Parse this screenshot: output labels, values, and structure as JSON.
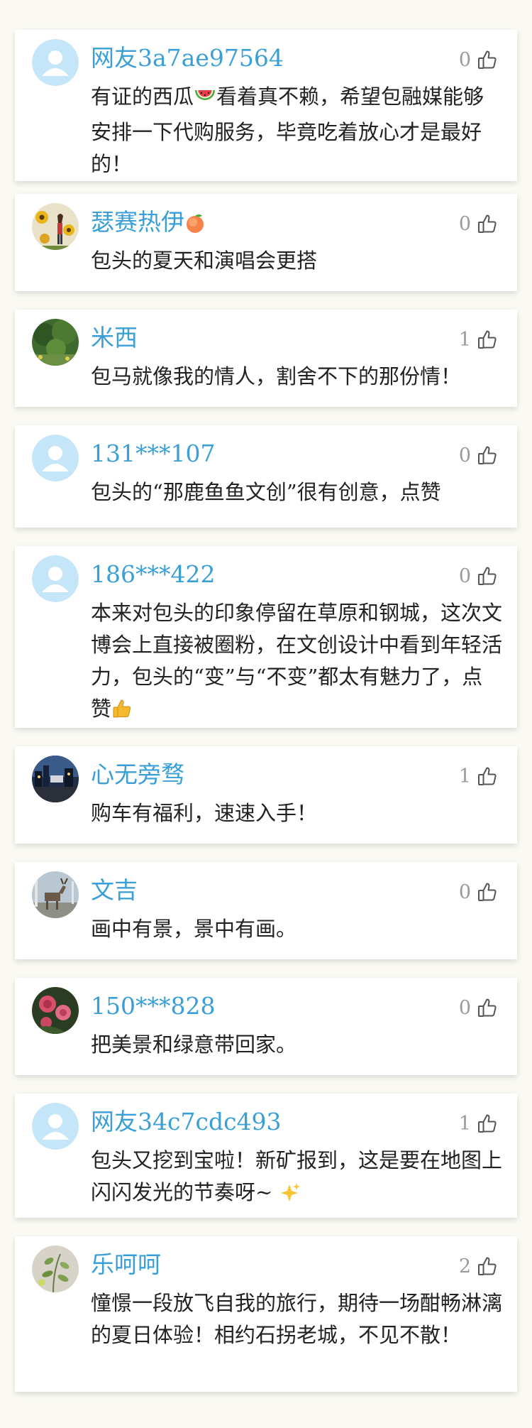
{
  "colors": {
    "page_background": "#faf9f3",
    "card_background": "#ffffff",
    "username": "#3a9fd6",
    "comment_text": "#222222",
    "like_count": "#9a9a9a",
    "default_avatar": "#c5e5f8"
  },
  "comments": [
    {
      "name": "网友3a7ae97564",
      "avatar": "default-avatar",
      "likes": "0",
      "segments": [
        "有证的西瓜",
        "watermelon-emoji",
        "看着真不赖，希望包融媒能够安排一下代购服务，毕竟吃着放心才是最好的！"
      ]
    },
    {
      "name": "瑟赛热伊",
      "name_emoji": "peach-emoji",
      "avatar": "photo-avatar-sunflowers",
      "likes": "0",
      "segments": [
        "包头的夏天和演唱会更搭"
      ]
    },
    {
      "name": "米西",
      "avatar": "photo-avatar-trees",
      "likes": "1",
      "segments": [
        "包马就像我的情人，割舍不下的那份情！"
      ]
    },
    {
      "name": "131***107",
      "avatar": "default-avatar",
      "likes": "0",
      "segments": [
        "包头的“那鹿鱼鱼文创”很有创意，点赞"
      ]
    },
    {
      "name": "186***422",
      "avatar": "default-avatar",
      "likes": "0",
      "segments": [
        "本来对包头的印象停留在草原和钢城，这次文博会上直接被圈粉，在文创设计中看到年轻活力，包头的“变”与“不变”都太有魅力了，点赞",
        "thumbs-up-emoji"
      ]
    },
    {
      "name": "心无旁骛",
      "avatar": "photo-avatar-night-city",
      "likes": "1",
      "segments": [
        "购车有福利，速速入手！"
      ]
    },
    {
      "name": "文吉",
      "avatar": "photo-avatar-deer-statue",
      "likes": "0",
      "segments": [
        "画中有景，景中有画。"
      ]
    },
    {
      "name": "150***828",
      "avatar": "photo-avatar-pink-flowers",
      "likes": "0",
      "segments": [
        "把美景和绿意带回家。"
      ]
    },
    {
      "name": "网友34c7cdc493",
      "avatar": "default-avatar",
      "likes": "1",
      "segments": [
        "包头又挖到宝啦！新矿报到，这是要在地图上闪闪发光的节奏呀~ ",
        "sparkles-emoji"
      ]
    },
    {
      "name": "乐呵呵",
      "avatar": "photo-avatar-plant",
      "likes": "2",
      "segments": [
        "憧憬一段放飞自我的旅行，期待一场酣畅淋漓的夏日体验！相约石拐老城，不见不散！"
      ]
    }
  ]
}
